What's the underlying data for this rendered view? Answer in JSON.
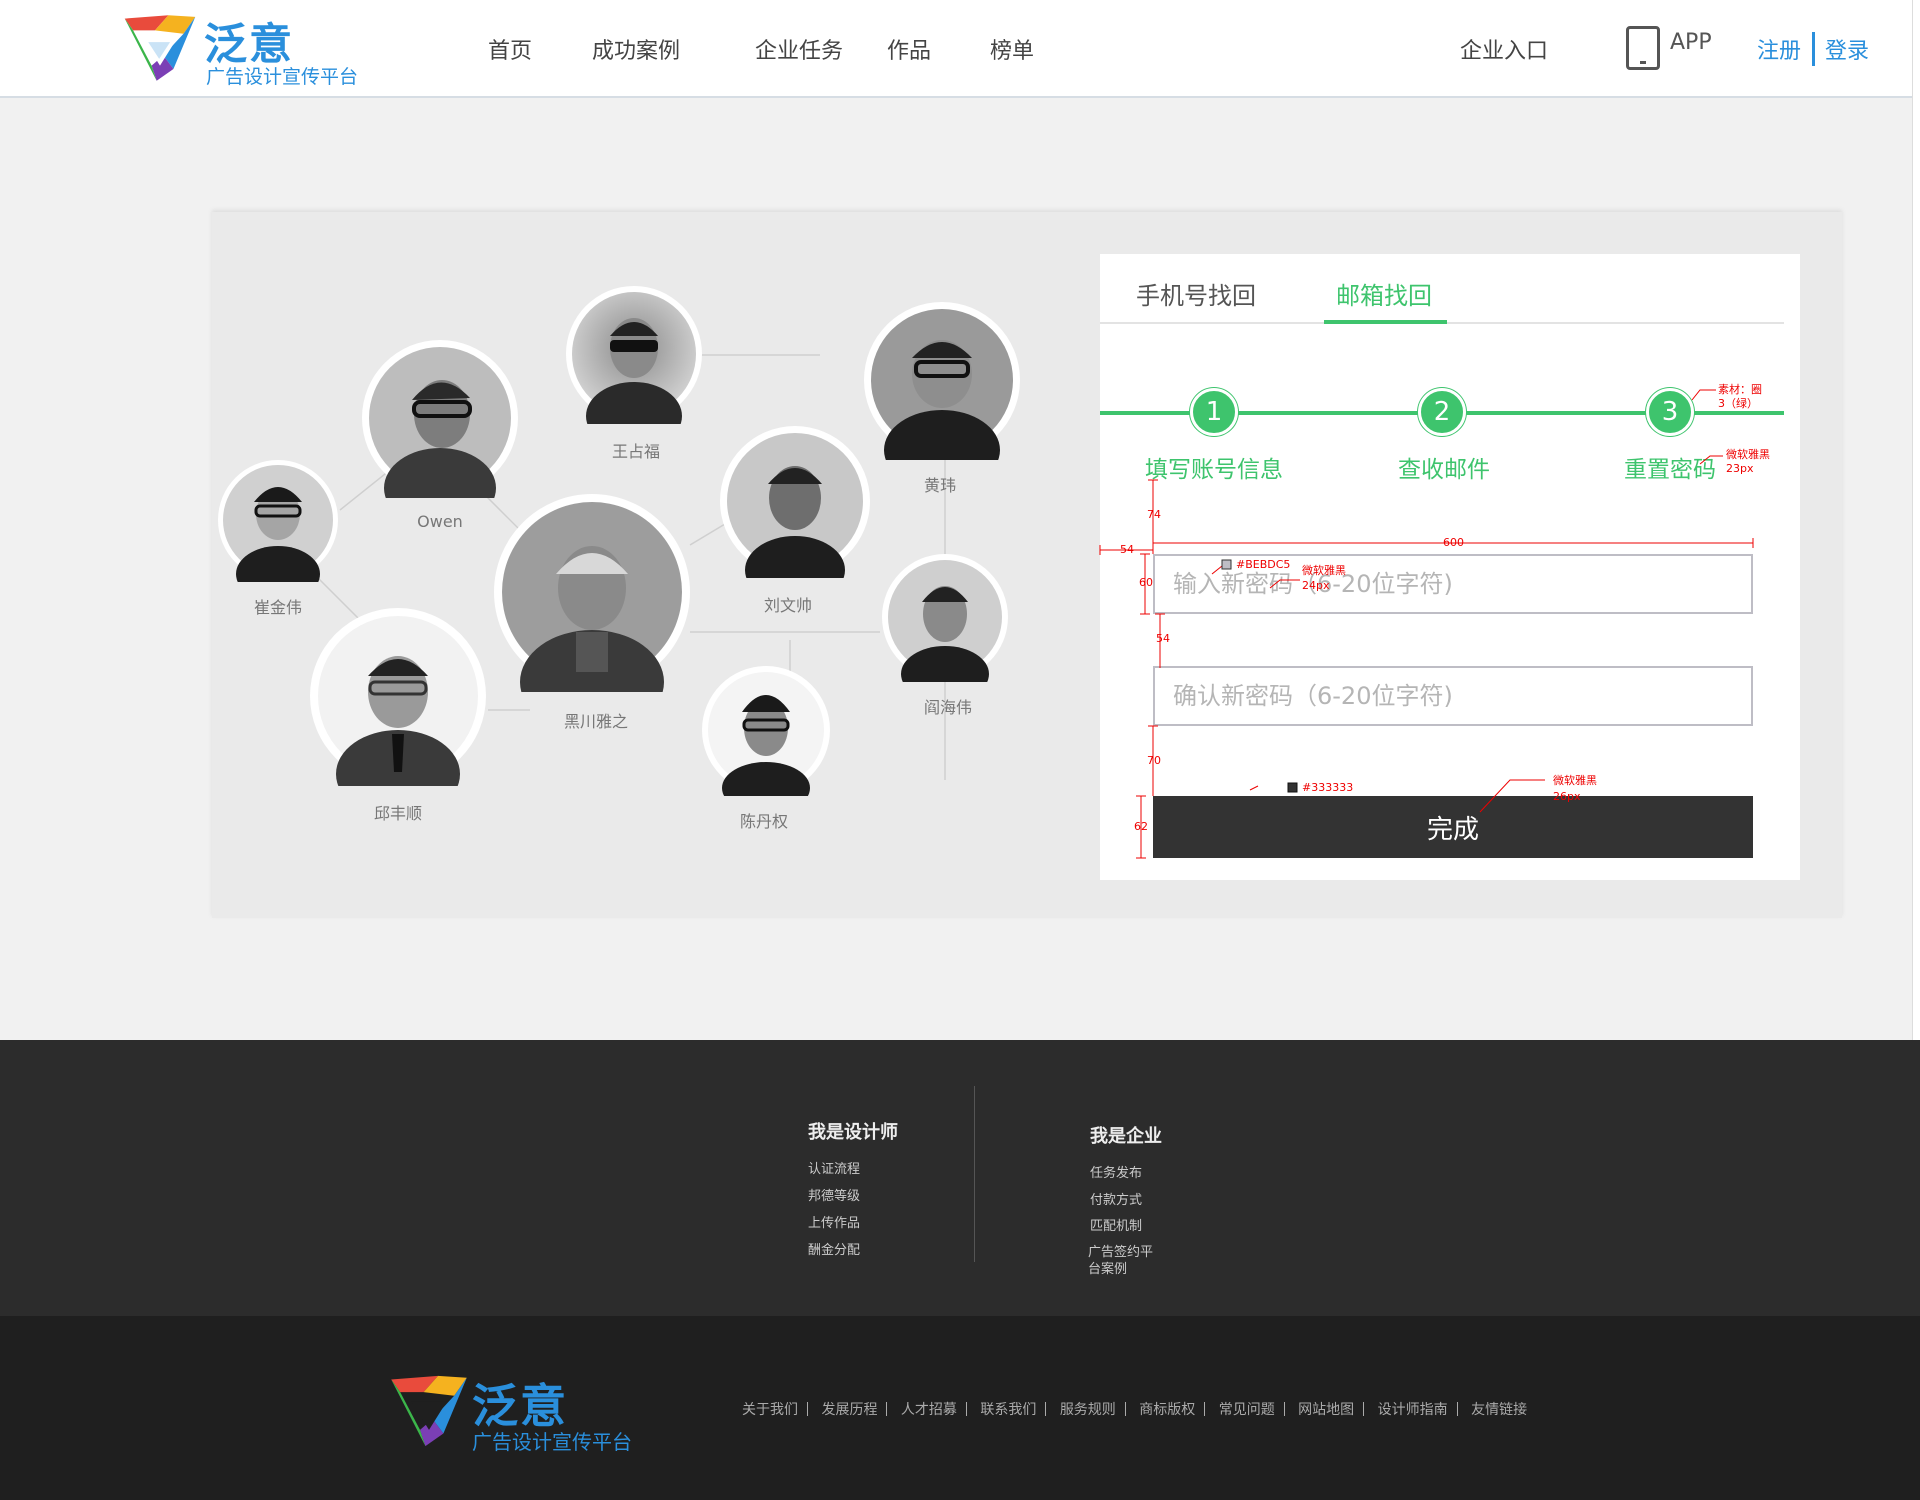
{
  "brand": {
    "name": "泛意",
    "slogan": "广告设计宣传平台"
  },
  "header": {
    "nav": [
      "首页",
      "成功案例",
      "企业任务",
      "作品",
      "榜单"
    ],
    "enterprise": "企业入口",
    "app": "APP",
    "register": "注册",
    "login": "登录"
  },
  "designers": {
    "names": [
      "王占福",
      "Owen",
      "黄玮",
      "崔金伟",
      "刘文帅",
      "黑川雅之",
      "阎海伟",
      "邱丰顺",
      "陈丹权"
    ]
  },
  "form": {
    "tabs": [
      "手机号找回",
      "邮箱找回"
    ],
    "active_tab": "邮箱找回",
    "steps": [
      {
        "num": "1",
        "label": "填写账号信息"
      },
      {
        "num": "2",
        "label": "查收邮件"
      },
      {
        "num": "3",
        "label": "重置密码"
      }
    ],
    "new_password_placeholder": "输入新密码（6-20位字符)",
    "confirm_password_placeholder": "确认新密码（6-20位字符)",
    "submit_label": "完成",
    "input_border_color": "#BEBDC5",
    "button_color": "#333333",
    "accent_color": "#3EC46D"
  },
  "annotations": {
    "material": "素材：圈",
    "material_sub": "3（绿）",
    "font_label_1": "微软雅黑",
    "font_size_1": "23px",
    "width_600": "600",
    "left_54": "54",
    "gap_74": "74",
    "height_60": "60",
    "gap_54": "54",
    "gap_70": "70",
    "height_62": "62",
    "color_border": "#BEBDC5",
    "font_label_2": "微软雅黑",
    "font_size_2": "24px",
    "color_button": "#333333",
    "font_label_3": "微软雅黑",
    "font_size_3": "26px"
  },
  "footer": {
    "designer_title": "我是设计师",
    "designer_links": [
      "认证流程",
      "邦德等级",
      "上传作品",
      "酬金分配"
    ],
    "enterprise_title": "我是企业",
    "enterprise_links": [
      "任务发布",
      "付款方式",
      "匹配机制",
      "广告签约平台案例"
    ],
    "bottom_links": [
      "关于我们",
      "发展历程",
      "人才招募",
      "联系我们",
      "服务规则",
      "商标版权",
      "常见问题",
      "网站地图",
      "设计师指南",
      "友情链接"
    ]
  }
}
